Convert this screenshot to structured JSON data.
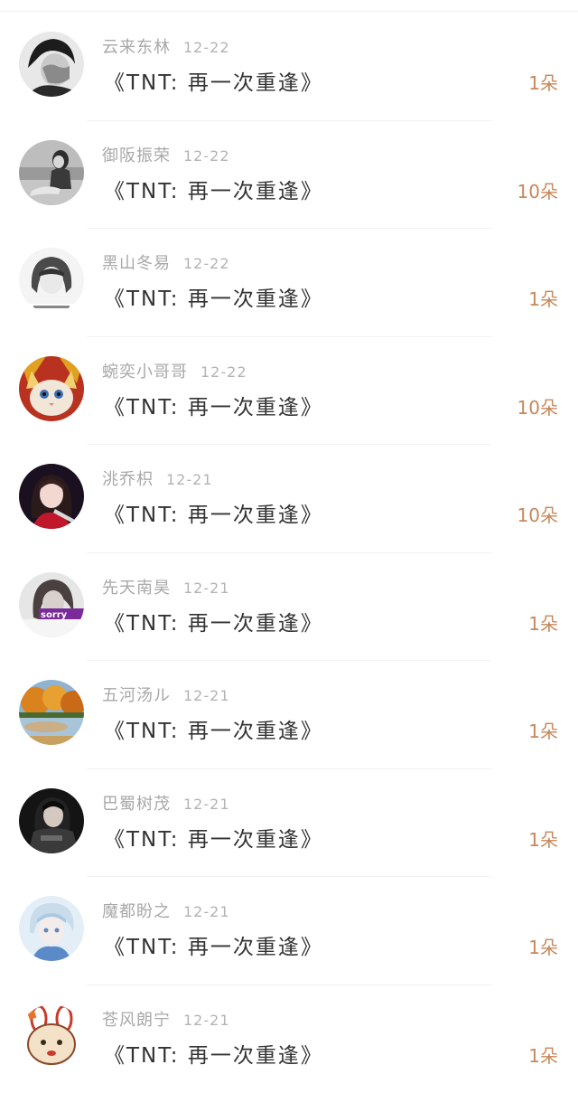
{
  "gift_list": {
    "items": [
      {
        "user": "云来东林",
        "date": "12-22",
        "gift": "《TNT:  再一次重逢》",
        "count": "1朵",
        "avatar": "woman-covering-face-avatar-icon"
      },
      {
        "user": "御阪振荣",
        "date": "12-22",
        "gift": "《TNT:  再一次重逢》",
        "count": "10朵",
        "avatar": "girl-by-sea-avatar-icon"
      },
      {
        "user": "黑山冬易",
        "date": "12-22",
        "gift": "《TNT:  再一次重逢》",
        "count": "1朵",
        "avatar": "girl-sketch-avatar-icon"
      },
      {
        "user": "蜿奕小哥哥",
        "date": "12-22",
        "gift": "《TNT:  再一次重逢》",
        "count": "10朵",
        "avatar": "cat-avatar-icon"
      },
      {
        "user": "洮乔枳",
        "date": "12-21",
        "gift": "《TNT:  再一次重逢》",
        "count": "10朵",
        "avatar": "girl-red-avatar-icon"
      },
      {
        "user": "先天南昊",
        "date": "12-21",
        "gift": "《TNT:  再一次重逢》",
        "count": "1朵",
        "avatar": "sorry-girl-avatar-icon"
      },
      {
        "user": "五河汤ル",
        "date": "12-21",
        "gift": "《TNT:  再一次重逢》",
        "count": "1朵",
        "avatar": "autumn-lake-avatar-icon"
      },
      {
        "user": "巴蜀树茂",
        "date": "12-21",
        "gift": "《TNT:  再一次重逢》",
        "count": "1朵",
        "avatar": "armored-girl-avatar-icon"
      },
      {
        "user": "魔都盼之",
        "date": "12-21",
        "gift": "《TNT:  再一次重逢》",
        "count": "1朵",
        "avatar": "anime-boy-avatar-icon"
      },
      {
        "user": "苍风朗宁",
        "date": "12-21",
        "gift": "《TNT:  再一次重逢》",
        "count": "1朵",
        "avatar": "bunny-cartoon-avatar-icon"
      }
    ]
  }
}
